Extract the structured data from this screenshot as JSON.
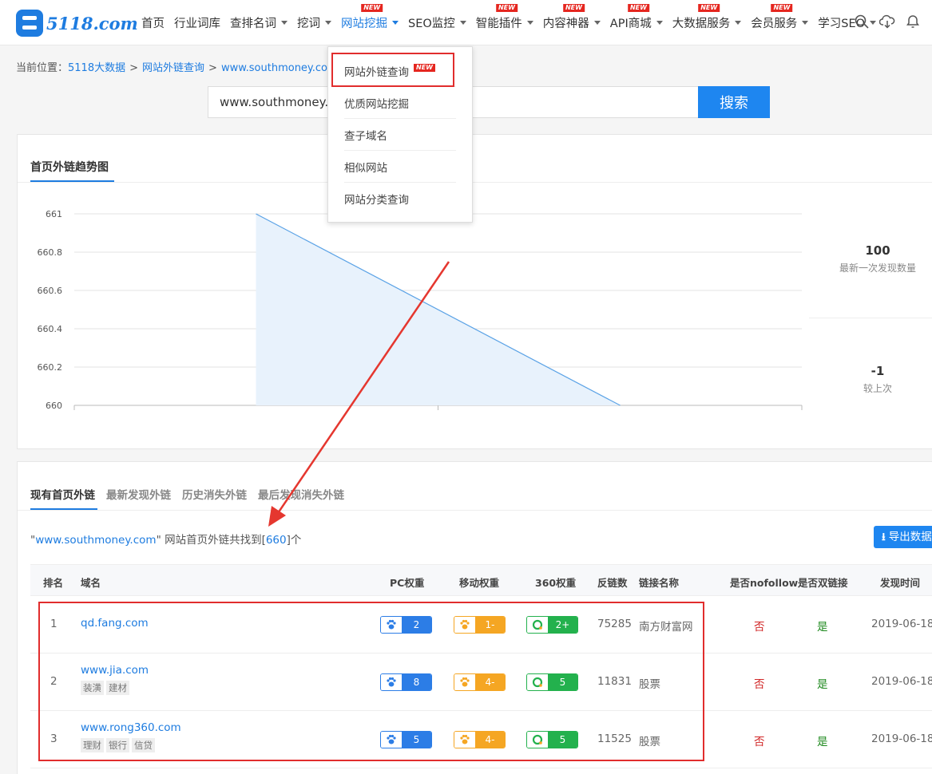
{
  "header": {
    "logo_text": "5118.com",
    "nav": [
      {
        "label": "首页",
        "caret": false,
        "new": false,
        "active": false
      },
      {
        "label": "行业词库",
        "caret": false,
        "new": false,
        "active": false
      },
      {
        "label": "查排名词",
        "caret": true,
        "new": false,
        "active": false
      },
      {
        "label": "挖词",
        "caret": true,
        "new": false,
        "active": false
      },
      {
        "label": "网站挖掘",
        "caret": true,
        "new": true,
        "active": true
      },
      {
        "label": "SEO监控",
        "caret": true,
        "new": false,
        "active": false
      },
      {
        "label": "智能插件",
        "caret": true,
        "new": true,
        "active": false
      },
      {
        "label": "内容神器",
        "caret": true,
        "new": true,
        "active": false
      },
      {
        "label": "API商城",
        "caret": true,
        "new": true,
        "active": false
      },
      {
        "label": "大数据服务",
        "caret": true,
        "new": true,
        "active": false
      },
      {
        "label": "会员服务",
        "caret": true,
        "new": true,
        "active": false
      },
      {
        "label": "学习SEO",
        "caret": true,
        "new": false,
        "active": false
      }
    ],
    "new_badge": "NEW",
    "icons": [
      "search-icon",
      "cloud-download-icon",
      "bell-icon"
    ]
  },
  "breadcrumb": {
    "prefix": "当前位置：",
    "items": [
      "5118大数据",
      "网站外链查询",
      "www.southmoney.com"
    ],
    "separator": ">"
  },
  "search": {
    "value": "www.southmoney.com",
    "button": "搜索"
  },
  "dropdown": {
    "items": [
      {
        "label": "网站外链查询",
        "new": true
      },
      {
        "label": "优质网站挖掘",
        "new": false
      },
      {
        "label": "查子域名",
        "new": false
      },
      {
        "label": "相似网站",
        "new": false
      },
      {
        "label": "网站分类查询",
        "new": false
      }
    ]
  },
  "trend": {
    "tab": "首页外链趋势图",
    "stats": [
      {
        "value": "100",
        "label": "最新一次发现数量"
      },
      {
        "value": "-1",
        "label": "较上次"
      }
    ]
  },
  "chart_data": {
    "type": "area",
    "x_points": 3,
    "values": [
      661,
      660
    ],
    "y_ticks": [
      "661",
      "660.8",
      "660.6",
      "660.4",
      "660.2",
      "660"
    ],
    "ylim": [
      660,
      661
    ],
    "grid": true,
    "colors": {
      "line": "#5aa2e6",
      "fill": "#e8f2fc"
    }
  },
  "links": {
    "tabs": [
      "现有首页外链",
      "最新发现外链",
      "历史消失外链",
      "最后发现消失外链"
    ],
    "summary_domain": "www.southmoney.com",
    "summary_mid": " 网站首页外链共找到[",
    "summary_count": "660",
    "summary_end": "]个",
    "export": "导出数据",
    "columns": [
      "排名",
      "域名",
      "PC权重",
      "移动权重",
      "360权重",
      "反链数",
      "链接名称",
      "是否nofollow",
      "是否双链接",
      "发现时间"
    ],
    "rows": [
      {
        "rank": "1",
        "domain": "qd.fang.com",
        "tags": [],
        "pc": "2",
        "mobile": "1-",
        "w360": "2+",
        "backlinks": "75285",
        "anchor": "南方财富网",
        "nofollow": "否",
        "double": "是",
        "date": "2019-06-18"
      },
      {
        "rank": "2",
        "domain": "www.jia.com",
        "tags": [
          "装潢",
          "建材"
        ],
        "pc": "8",
        "mobile": "4-",
        "w360": "5",
        "backlinks": "11831",
        "anchor": "股票",
        "nofollow": "否",
        "double": "是",
        "date": "2019-06-18"
      },
      {
        "rank": "3",
        "domain": "www.rong360.com",
        "tags": [
          "理财",
          "银行",
          "信贷"
        ],
        "pc": "5",
        "mobile": "4-",
        "w360": "5",
        "backlinks": "11525",
        "anchor": "股票",
        "nofollow": "否",
        "double": "是",
        "date": "2019-06-18"
      }
    ]
  },
  "colors": {
    "accent": "#1e7ce0",
    "highlight": "#e12d2d",
    "new_badge": "#e5261f"
  }
}
